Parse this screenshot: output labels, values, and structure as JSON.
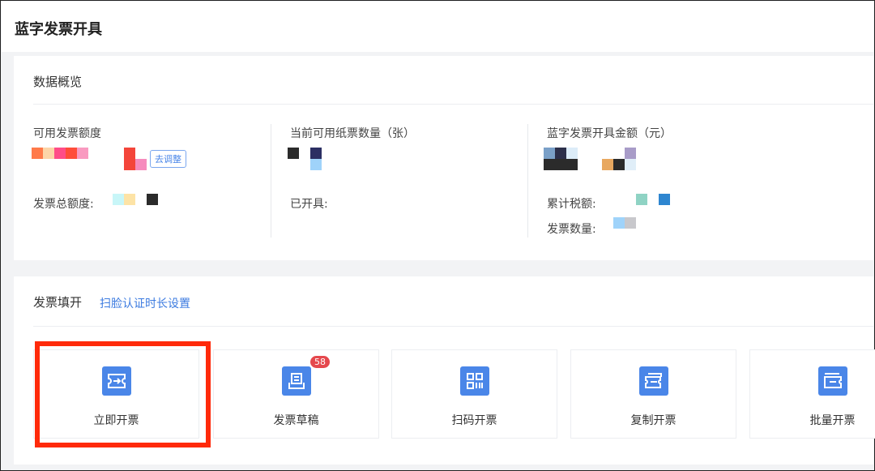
{
  "header": {
    "title": "蓝字发票开具"
  },
  "overview": {
    "title": "数据概览",
    "col1": {
      "label": "可用发票额度",
      "adjust_button": "去调整",
      "total_label": "发票总额度:"
    },
    "col2": {
      "label": "当前可用纸票数量（张）",
      "issued_label": "已开具:"
    },
    "col3": {
      "label": "蓝字发票开具金额（元）",
      "tax_label": "累计税额:",
      "count_label": "发票数量:"
    }
  },
  "issue": {
    "title": "发票填开",
    "face_auth_link": "扫脸认证时长设置",
    "tiles": [
      {
        "label": "立即开票",
        "icon": "ticket-arrow-icon"
      },
      {
        "label": "发票草稿",
        "icon": "draft-tray-icon",
        "badge": "58"
      },
      {
        "label": "扫码开票",
        "icon": "qr-code-icon"
      },
      {
        "label": "复制开票",
        "icon": "copy-ticket-icon"
      },
      {
        "label": "批量开票",
        "icon": "batch-ticket-icon"
      }
    ]
  },
  "colors": {
    "accent": "#4a86e8",
    "highlight": "#ff2a0a",
    "badge": "#e5484d"
  }
}
